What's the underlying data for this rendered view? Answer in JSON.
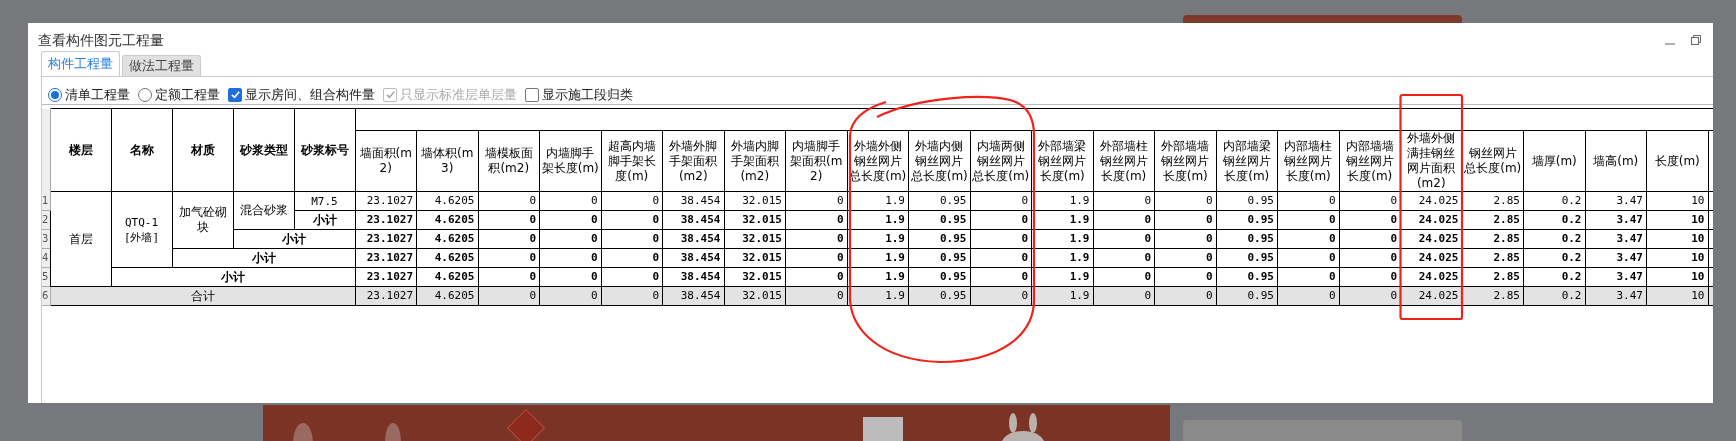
{
  "window": {
    "title": "查看构件图元工程量"
  },
  "tabs": [
    {
      "label": "构件工程量",
      "selected": true
    },
    {
      "label": "做法工程量",
      "selected": false
    }
  ],
  "options": [
    {
      "kind": "radio",
      "label": "清单工程量",
      "checked": true,
      "disabled": false
    },
    {
      "kind": "radio",
      "label": "定额工程量",
      "checked": false,
      "disabled": false
    },
    {
      "kind": "checkbox",
      "label": "显示房间、组合构件量",
      "checked": true,
      "disabled": false
    },
    {
      "kind": "checkbox",
      "label": "只显示标准层单层量",
      "checked": true,
      "disabled": true
    },
    {
      "kind": "checkbox",
      "label": "显示施工段归类",
      "checked": false,
      "disabled": false
    }
  ],
  "table": {
    "label_columns": [
      "楼层",
      "名称",
      "材质",
      "砂浆类型",
      "砂浆标号"
    ],
    "value_columns": [
      "墙面积(m2)",
      "墙体积(m3)",
      "墙模板面积(m2)",
      "内墙脚手架长度(m)",
      "超高内墙脚手架长度(m)",
      "外墙外脚手架面积(m2)",
      "外墙内脚手架面积(m2)",
      "内墙脚手架面积(m2)",
      "外墙外侧钢丝网片总长度(m)",
      "外墙内侧钢丝网片总长度(m)",
      "内墙两侧钢丝网片总长度(m)",
      "外部墙梁钢丝网片长度(m)",
      "外部墙柱钢丝网片长度(m)",
      "外部墙墙钢丝网片长度(m)",
      "内部墙梁钢丝网片长度(m)",
      "内部墙柱钢丝网片长度(m)",
      "内部墙墙钢丝网片长度(m)",
      "外墙外侧满挂钢丝网片面积(m2)",
      "钢丝网片总长度(m)",
      "墙厚(m)",
      "墙高(m)",
      "长度(m)"
    ],
    "rows": [
      {
        "number": "1",
        "kind": "item",
        "labels": [
          "首层",
          "QTQ-1 [外墙]",
          "加气砼砌块",
          "混合砂浆",
          "M7.5"
        ],
        "values": [
          "23.1027",
          "4.6205",
          "0",
          "0",
          "0",
          "38.454",
          "32.015",
          "0",
          "1.9",
          "0.95",
          "0",
          "1.9",
          "0",
          "0",
          "0.95",
          "0",
          "0",
          "24.025",
          "2.85",
          "0.2",
          "3.47",
          "10"
        ]
      },
      {
        "number": "2",
        "kind": "subtotal",
        "labels": [
          "小计"
        ],
        "values": [
          "23.1027",
          "4.6205",
          "0",
          "0",
          "0",
          "38.454",
          "32.015",
          "0",
          "1.9",
          "0.95",
          "0",
          "1.9",
          "0",
          "0",
          "0.95",
          "0",
          "0",
          "24.025",
          "2.85",
          "0.2",
          "3.47",
          "10"
        ]
      },
      {
        "number": "3",
        "kind": "subtotal",
        "labels": [
          "小计"
        ],
        "values": [
          "23.1027",
          "4.6205",
          "0",
          "0",
          "0",
          "38.454",
          "32.015",
          "0",
          "1.9",
          "0.95",
          "0",
          "1.9",
          "0",
          "0",
          "0.95",
          "0",
          "0",
          "24.025",
          "2.85",
          "0.2",
          "3.47",
          "10"
        ]
      },
      {
        "number": "4",
        "kind": "subtotal",
        "labels": [
          "小计"
        ],
        "values": [
          "23.1027",
          "4.6205",
          "0",
          "0",
          "0",
          "38.454",
          "32.015",
          "0",
          "1.9",
          "0.95",
          "0",
          "1.9",
          "0",
          "0",
          "0.95",
          "0",
          "0",
          "24.025",
          "2.85",
          "0.2",
          "3.47",
          "10"
        ]
      },
      {
        "number": "5",
        "kind": "subtotal",
        "labels": [
          "小计"
        ],
        "values": [
          "23.1027",
          "4.6205",
          "0",
          "0",
          "0",
          "38.454",
          "32.015",
          "0",
          "1.9",
          "0.95",
          "0",
          "1.9",
          "0",
          "0",
          "0.95",
          "0",
          "0",
          "24.025",
          "2.85",
          "0.2",
          "3.47",
          "10"
        ]
      },
      {
        "number": "6",
        "kind": "total",
        "labels": [
          "合计"
        ],
        "values": [
          "23.1027",
          "4.6205",
          "0",
          "0",
          "0",
          "38.454",
          "32.015",
          "0",
          "1.9",
          "0.95",
          "0",
          "1.9",
          "0",
          "0",
          "0.95",
          "0",
          "0",
          "24.025",
          "2.85",
          "0.2",
          "3.47",
          "10"
        ]
      }
    ]
  }
}
